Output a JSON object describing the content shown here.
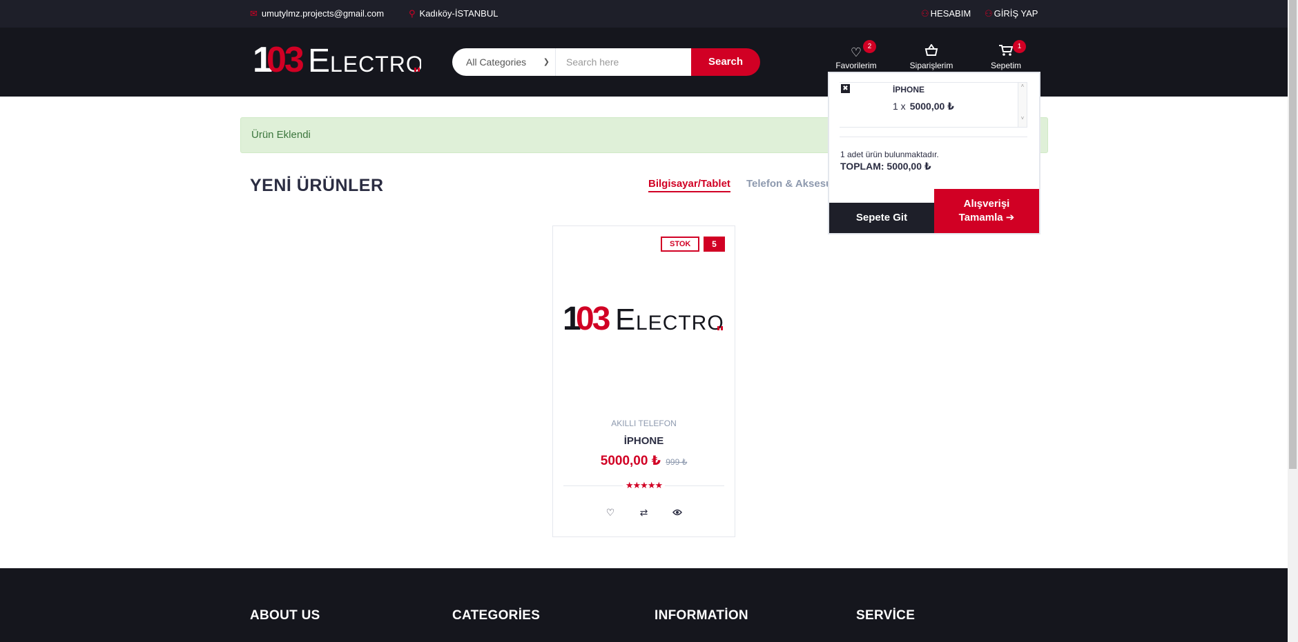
{
  "topbar": {
    "email": "umutylmz.projects@gmail.com",
    "location": "Kadıköy-İSTANBUL",
    "account": "HESABIM",
    "login": "GİRİŞ YAP"
  },
  "header": {
    "logo_text": "103Electro",
    "search": {
      "category": "All Categories",
      "placeholder": "Search here",
      "button": "Search"
    },
    "favorites": {
      "label": "Favorilerim",
      "count": "2"
    },
    "orders": {
      "label": "Siparişlerim"
    },
    "cart": {
      "label": "Sepetim",
      "count": "1"
    }
  },
  "cart_dropdown": {
    "item": {
      "name": "İPHONE",
      "qty": "1 x",
      "price": "5000,00 ₺"
    },
    "count_text": "1 adet ürün bulunmaktadır.",
    "total_text": "TOPLAM: 5000,00 ₺",
    "go_to_cart": "Sepete Git",
    "checkout_line1": "Alışverişi",
    "checkout_line2": "Tamamla"
  },
  "alert": {
    "text": "Ürün Eklendi"
  },
  "section": {
    "title": "YENİ ÜRÜNLER",
    "tabs": [
      {
        "label": "Bilgisayar/Tablet",
        "active": true
      },
      {
        "label": "Telefon & Aksesuar",
        "active": false
      }
    ]
  },
  "product": {
    "stock_label": "STOK",
    "stock_count": "5",
    "category": "AKILLI TELEFON",
    "name": "İPHONE",
    "price": "5000,00 ₺",
    "old_price": "999 ₺",
    "rating": 5
  },
  "footer": {
    "headings": [
      "ABOUT US",
      "CATEGORİES",
      "INFORMATİON",
      "SERVİCE"
    ]
  },
  "colors": {
    "accent": "#d10024",
    "dark": "#15161d",
    "topbar": "#1e1f29"
  },
  "icons": {
    "email": "envelope-icon",
    "location": "map-marker-icon",
    "user": "user-icon",
    "favorites": "heart-icon",
    "orders": "basket-icon",
    "cart": "cart-icon",
    "delete": "close-icon",
    "wishlist": "heart-icon",
    "compare": "exchange-icon",
    "quickview": "eye-icon",
    "checkout_arrow": "arrow-circle-right-icon"
  }
}
